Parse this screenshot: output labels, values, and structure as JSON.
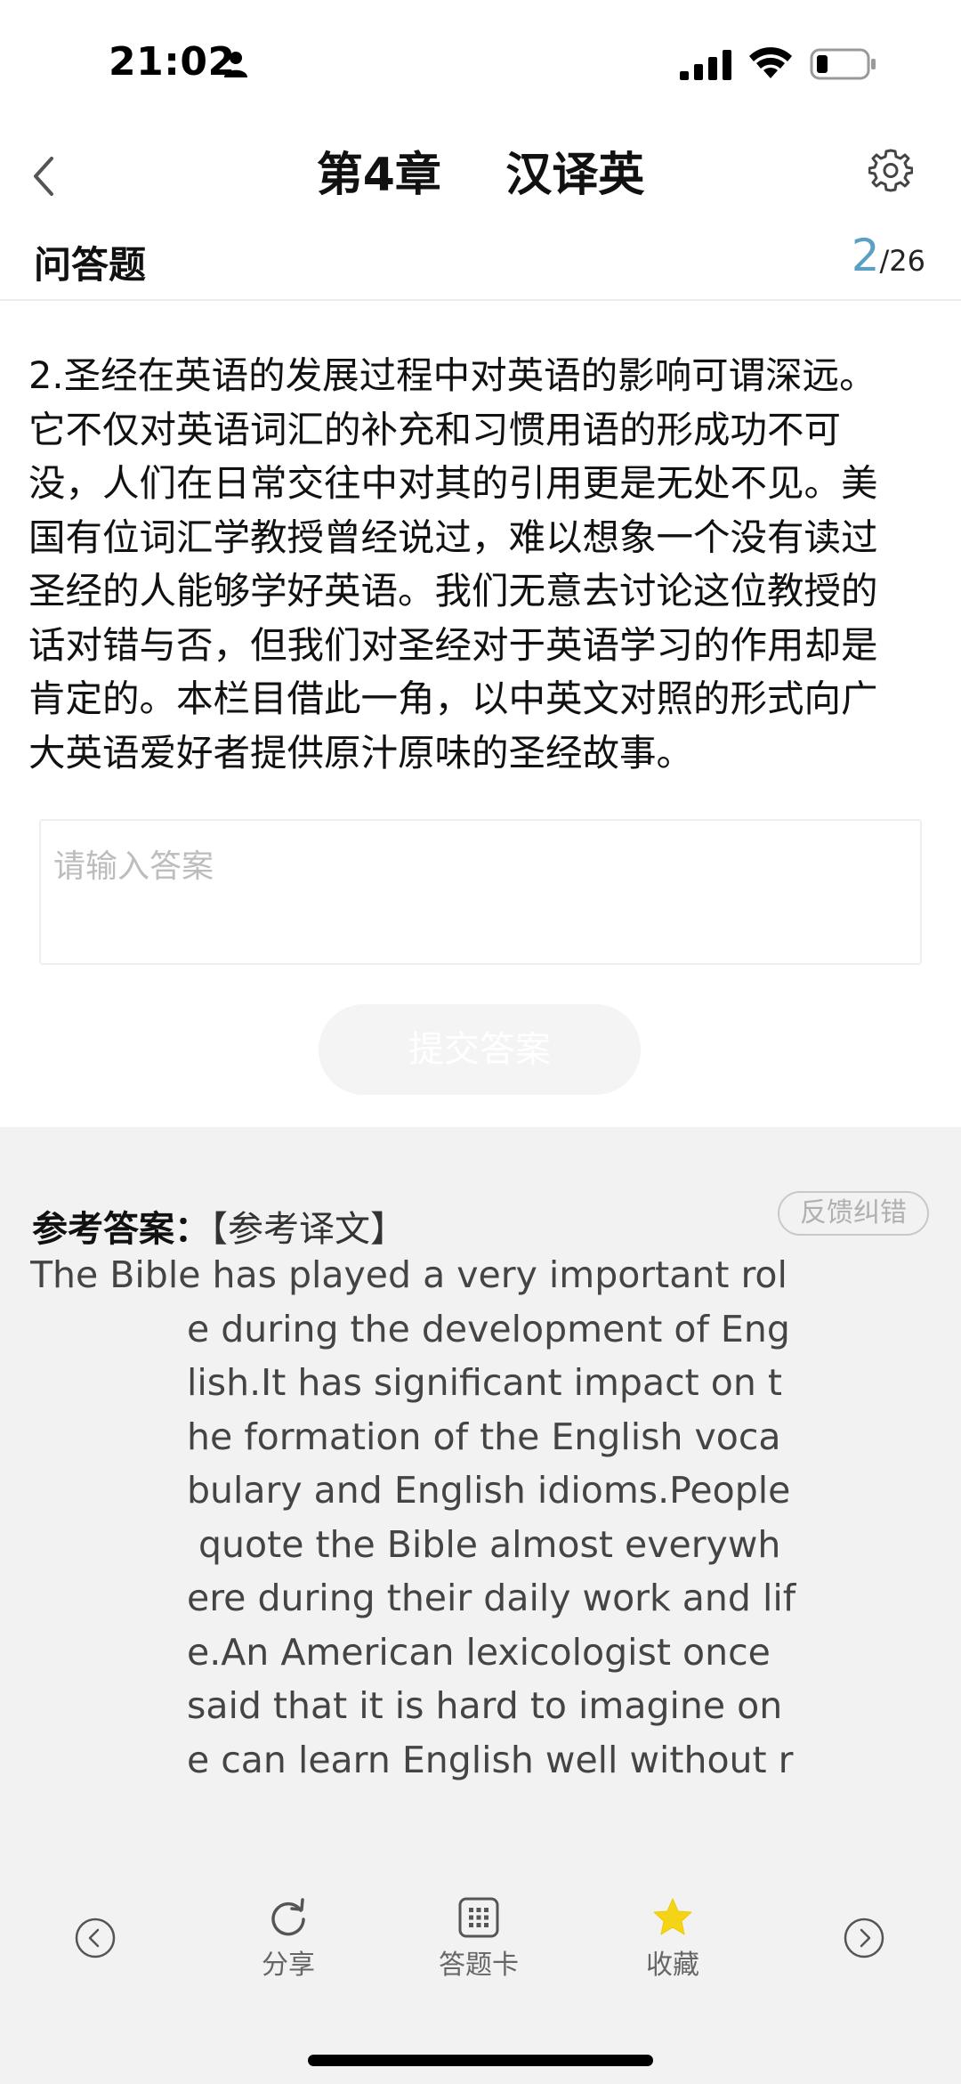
{
  "status": {
    "time": "21:02"
  },
  "nav": {
    "title_chapter": "第4章",
    "title_topic": "汉译英"
  },
  "question": {
    "type_label": "问答题",
    "current": "2",
    "total": "/26",
    "text": "2.圣经在英语的发展过程中对英语的影响可谓深远。\n它不仅对英语词汇的补充和习惯用语的形成功不可\n没，人们在日常交往中对其的引用更是无处不见。美\n国有位词汇学教授曾经说过，难以想象一个没有读过\n圣经的人能够学好英语。我们无意去讨论这位教授的\n话对错与否，但我们对圣经对于英语学习的作用却是\n肯定的。本栏目借此一角，以中英文对照的形式向广\n大英语爱好者提供原汁原味的圣经故事。"
  },
  "answer": {
    "placeholder": "请输入答案",
    "submit_label": "提交答案"
  },
  "reference": {
    "label": "参考答案：",
    "tag": "【参考译文】",
    "feedback_label": "反馈纠错",
    "lines": [
      "The Bible has played a very important rol",
      "e during the development of Eng",
      "lish.It has significant impact on t",
      "he formation of the English voca",
      "bulary and English idioms.People",
      " quote the Bible almost everywh",
      "ere during their daily work and lif",
      "e.An American lexicologist once",
      "said that it is hard to imagine on",
      "e can learn English well without r"
    ]
  },
  "toolbar": {
    "share_label": "分享",
    "card_label": "答题卡",
    "favorite_label": "收藏"
  },
  "colors": {
    "accent": "#5a9fc4",
    "star": "#f5d417",
    "panel_bg": "#f2f2f2"
  }
}
